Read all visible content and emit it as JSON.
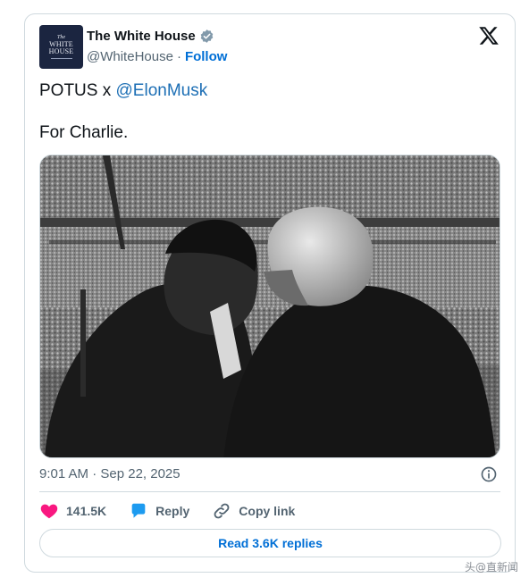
{
  "account": {
    "display_name": "The White House",
    "handle": "@WhiteHouse",
    "separator": "·",
    "follow_label": "Follow",
    "avatar_line1": "The",
    "avatar_line2": "WHITE",
    "avatar_line3": "HOUSE"
  },
  "tweet": {
    "text_prefix": "POTUS x ",
    "mention": "@ElonMusk",
    "text_line2": "For Charlie.",
    "timestamp": "9:01 AM · Sep 22, 2025"
  },
  "actions": {
    "likes": "141.5K",
    "reply_label": "Reply",
    "copy_label": "Copy link",
    "read_replies_label": "Read 3.6K replies"
  },
  "watermark": "头@直新闻",
  "colors": {
    "link": "#006fd6",
    "heart": "#f91880",
    "reply_bubble": "#1d9bf0",
    "text_secondary": "#536471",
    "border": "#cfd9de"
  },
  "icons": [
    "verified-badge-icon",
    "x-logo-icon",
    "info-icon",
    "heart-icon",
    "reply-bubble-icon",
    "link-icon"
  ]
}
